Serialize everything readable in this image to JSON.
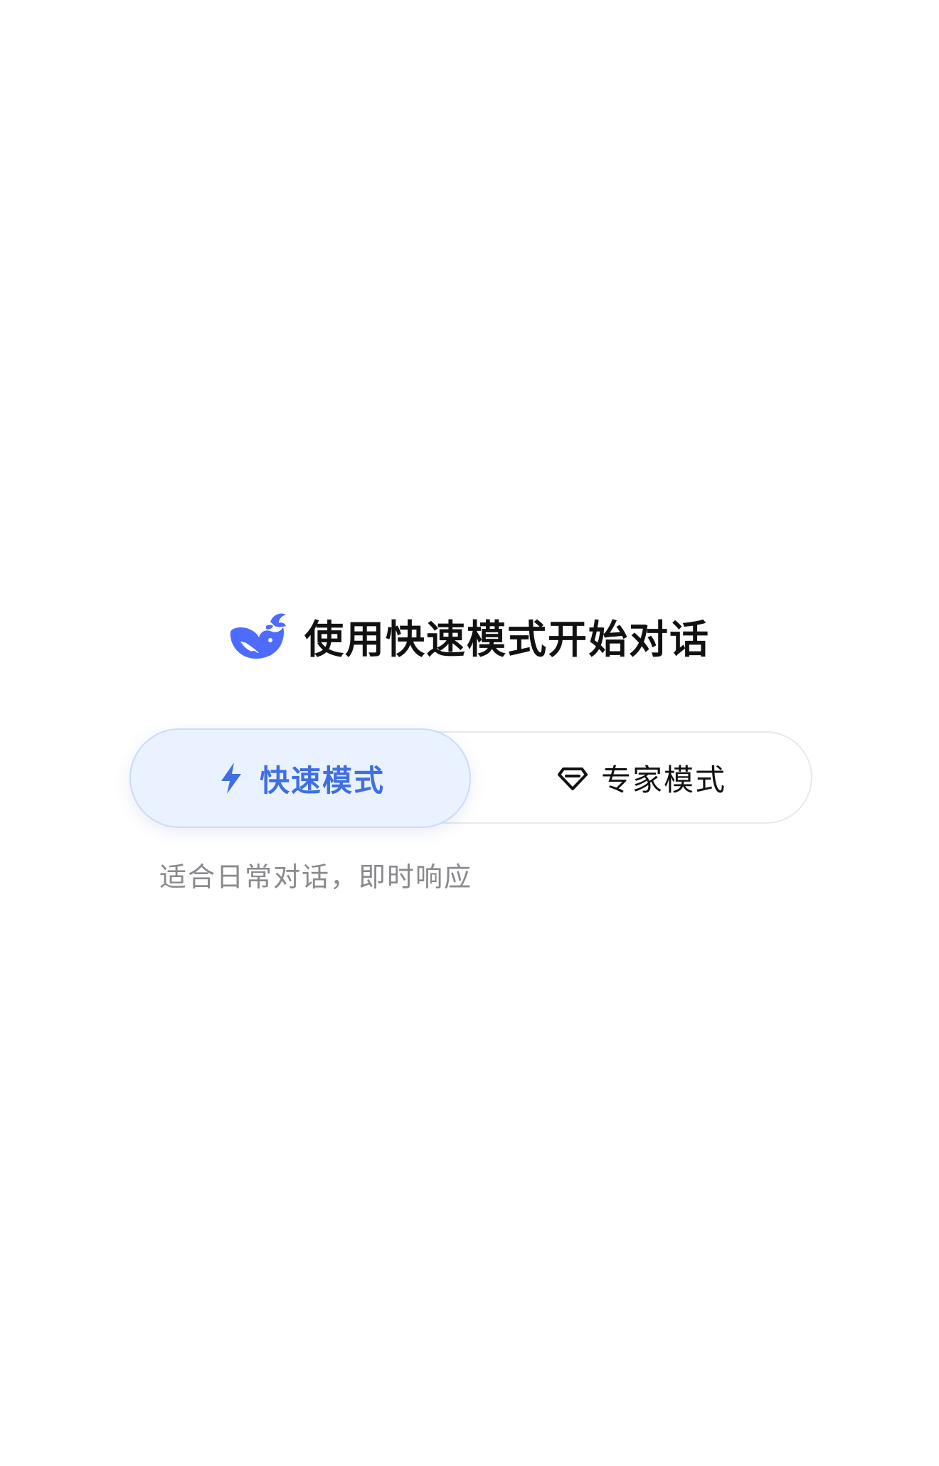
{
  "header": {
    "logo_icon": "deepseek-whale-icon",
    "title": "使用快速模式开始对话"
  },
  "mode_toggle": {
    "selected": "fast",
    "fast": {
      "icon": "lightning-bolt-icon",
      "label": "快速模式"
    },
    "expert": {
      "icon": "diamond-icon",
      "label": "专家模式"
    }
  },
  "description": "适合日常对话，即时响应",
  "colors": {
    "accent": "#4d6bfe",
    "selected_text": "#3f6fe0",
    "selected_bg": "#eaf2ff",
    "selected_border": "#c9dcf8",
    "title_text": "#111111",
    "description_text": "#8a8a8e",
    "track_border": "#e8e8ec"
  }
}
